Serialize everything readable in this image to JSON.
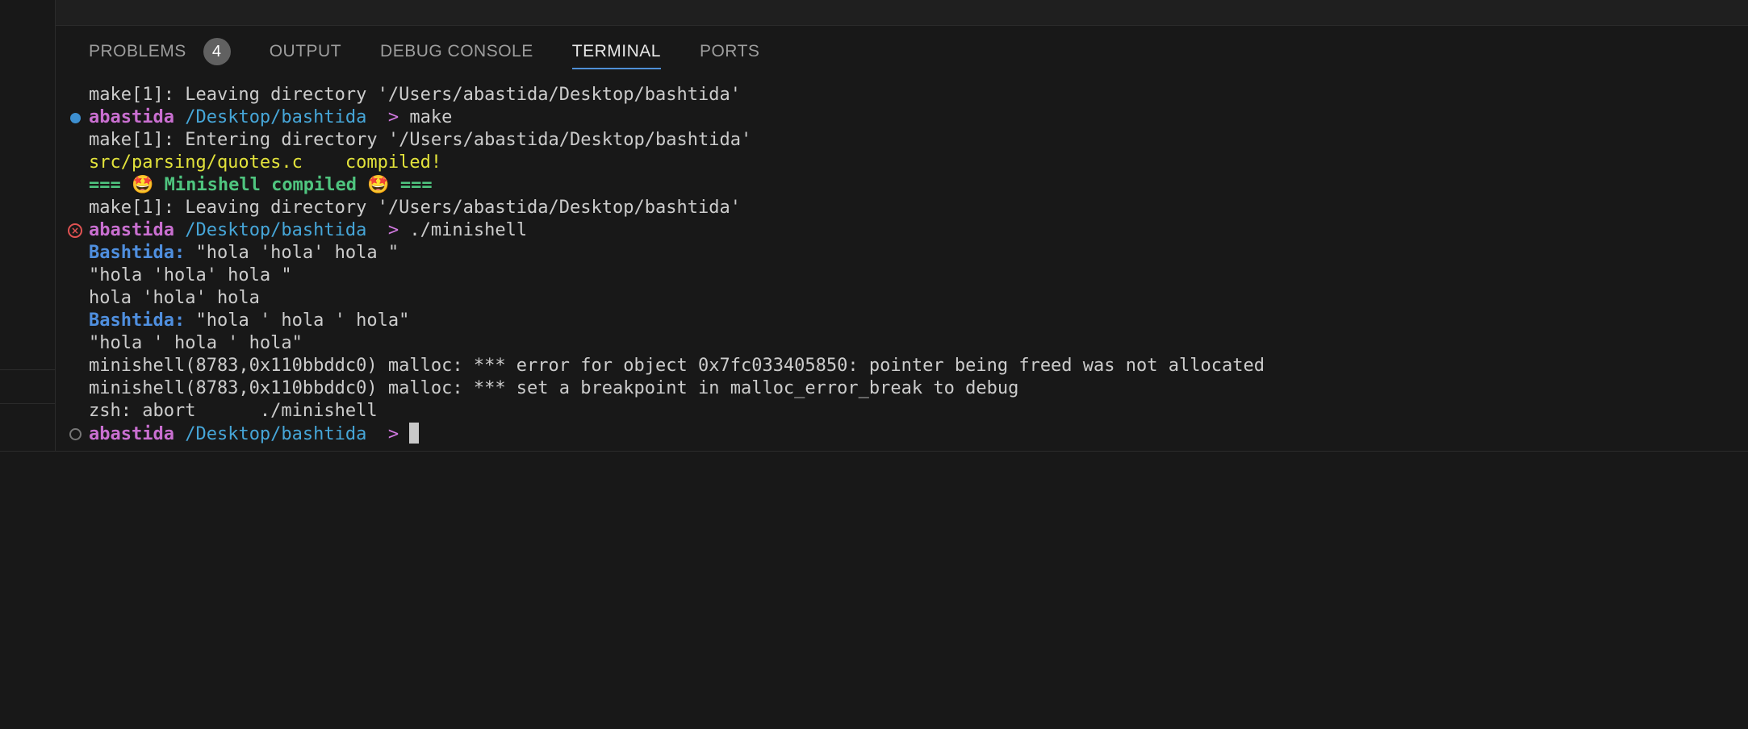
{
  "tabs": [
    {
      "label": "PROBLEMS",
      "badge": "4"
    },
    {
      "label": "OUTPUT"
    },
    {
      "label": "DEBUG CONSOLE"
    },
    {
      "label": "TERMINAL"
    },
    {
      "label": "PORTS"
    }
  ],
  "active_tab": "TERMINAL",
  "terminal": {
    "lines": [
      "make[1]: Leaving directory '/Users/abastida/Desktop/bashtida'",
      {
        "user": "abastida",
        "path": "/Desktop/bashtida",
        "prompt": ">",
        "command": "make",
        "status": "success"
      },
      "make[1]: Entering directory '/Users/abastida/Desktop/bashtida'",
      {
        "file": "src/parsing/quotes.c",
        "message": "compiled!"
      },
      "=== 🤩 Minishell compiled 🤩 ===",
      "make[1]: Leaving directory '/Users/abastida/Desktop/bashtida'",
      {
        "user": "abastida",
        "path": "/Desktop/bashtida",
        "prompt": ">",
        "command": "./minishell",
        "status": "error"
      },
      {
        "shell_prompt": "Bashtida:",
        "input": "\"hola 'hola' hola \""
      },
      "\"hola 'hola' hola \"",
      "hola 'hola' hola",
      {
        "shell_prompt": "Bashtida:",
        "input": "\"hola ' hola ' hola\""
      },
      "\"hola ' hola ' hola\"",
      "minishell(8783,0x110bbddc0) malloc: *** error for object 0x7fc033405850: pointer being freed was not allocated",
      "minishell(8783,0x110bbddc0) malloc: *** set a breakpoint in malloc_error_break to debug",
      "zsh: abort      ./minishell",
      {
        "user": "abastida",
        "path": "/Desktop/bashtida",
        "prompt": ">",
        "command": "",
        "status": "pending"
      }
    ]
  },
  "colors": {
    "background": "#181818",
    "user": "#c96fd0",
    "path": "#46a6d8",
    "compiled": "#e2e23b",
    "banner": "#4fc57f",
    "shell_prompt": "#4f8fdf",
    "error_mark": "#e05252",
    "success_mark": "#3d8fd0",
    "active_tab_underline": "#4f8fd6"
  }
}
